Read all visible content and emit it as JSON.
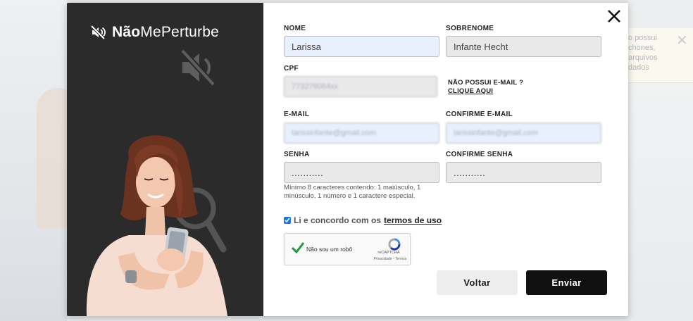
{
  "background": {
    "notice_text": "o possui\nchones,\narquivos\ndados",
    "notice_close_icon": "close-icon"
  },
  "brand": {
    "name_bold": "Não",
    "name_regular": "MePerturbe",
    "icon": "speaker-muted-icon"
  },
  "form": {
    "nome": {
      "label": "NOME",
      "value": "Larissa"
    },
    "sobrenome": {
      "label": "SOBRENOME",
      "value": "Infante Hecht"
    },
    "cpf": {
      "label": "CPF",
      "value": "773276064xx"
    },
    "no_email": {
      "question": "NÃO POSSUI E-MAIL ?",
      "link": "CLIQUE AQUI"
    },
    "email": {
      "label": "E-MAIL",
      "value": "larissinfante@gmail.com"
    },
    "confirm_email": {
      "label": "CONFIRME E-MAIL",
      "value": "larissinfante@gmail.com"
    },
    "senha": {
      "label": "SENHA",
      "value": "..........."
    },
    "confirm_senha": {
      "label": "CONFIRME SENHA",
      "value": "..........."
    },
    "password_hint": "Mínimo 8 caracteres contendo: 1 maiúsculo, 1 minúsculo, 1 número e 1 caractere especial.",
    "terms": {
      "text": "Li e concordo com os",
      "link": "termos de uso",
      "checked": true
    },
    "captcha": {
      "label": "Não sou um robô",
      "brand": "reCAPTCHA",
      "links": "Privacidade - Termos",
      "checked": true
    },
    "buttons": {
      "back": "Voltar",
      "send": "Enviar"
    }
  },
  "colors": {
    "sidebar": "#2b2b2b",
    "autofill": "#e8f0fe",
    "disabled": "#e9e9e9",
    "primary_button": "#111111"
  }
}
